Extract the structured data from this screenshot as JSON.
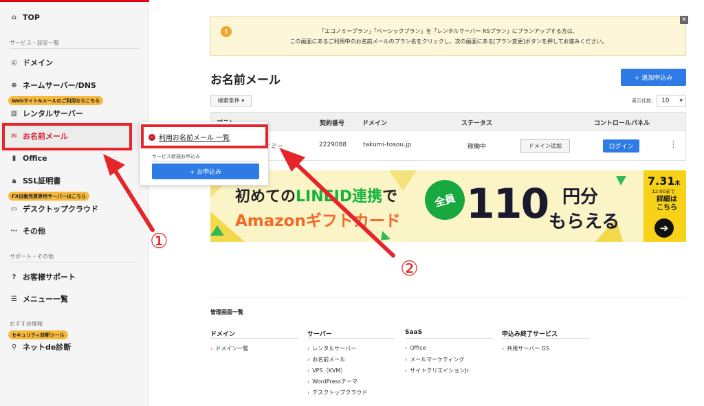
{
  "sidebar": {
    "top_label": "TOP",
    "section1": "サービス・設定一覧",
    "items": [
      {
        "label": "ドメイン",
        "icon": "domain-icon"
      },
      {
        "label": "ネームサーバー/DNS",
        "icon": "dns-icon"
      },
      {
        "label": "レンタルサーバー",
        "icon": "server-icon"
      },
      {
        "label": "お名前メール",
        "icon": "mail-icon"
      },
      {
        "label": "Office",
        "icon": "office-icon"
      },
      {
        "label": "SSL証明書",
        "icon": "lock-icon"
      },
      {
        "label": "デスクトップクラウド",
        "icon": "desktop-icon"
      },
      {
        "label": "その他",
        "icon": "more-icon"
      }
    ],
    "badge_web": "Webサイト&メールのご利用ならこちら",
    "badge_fx": "FX自動売買専用サーバーはこちら",
    "section2": "サポート・その他",
    "support_items": [
      {
        "label": "お客様サポート",
        "icon": "help-icon"
      },
      {
        "label": "メニュー一覧",
        "icon": "list-icon"
      }
    ],
    "section3": "おすすめ情報",
    "badge_security": "セキュリティ診断ツール",
    "recommend_item": "ネットde診断"
  },
  "popup": {
    "link": "利用お名前メール 一覧",
    "sub_heading": "サービス新規お申込み",
    "apply_button": "+ お申込み"
  },
  "notice": {
    "line1": "「エコノミープラン」「ベーシックプラン」を「レンタルサーバー RSプラン」にプランアップする方は、",
    "line2": "この画面にあるご利用中のお名前メールのプラン名をクリックし、次の画面にある[プラン変更]ボタンを押してお進みください。",
    "close": "✕"
  },
  "main": {
    "title": "お名前メール",
    "add_button": "+ 追加申込み",
    "filter": "検索条件 ▾",
    "count_label": "表示件数：",
    "count_value": "10",
    "table": {
      "headers": [
        "プラン",
        "契約番号",
        "ドメイン",
        "ステータス",
        "コントロールパネル"
      ],
      "row": {
        "plan": "エコノミー",
        "contract": "2229088",
        "domain": "takumi-tosou.jp",
        "status": "稼働中",
        "domain_add": "ドメイン追加",
        "login": "ログイン"
      }
    }
  },
  "banner": {
    "line1a": "初めての",
    "line1b": "LINEID連携",
    "line1c": "で",
    "line2": "Amazonギフトカード",
    "badge": "全員",
    "amount": "110",
    "yen": "円分",
    "receive": "もらえる",
    "date": "7.31",
    "weekday": "木",
    "until": "12:00まで",
    "details": "詳細は こちら"
  },
  "footer": {
    "title": "管理画面一覧",
    "columns": [
      {
        "heading": "ドメイン",
        "links": [
          "ドメイン一覧"
        ]
      },
      {
        "heading": "サーバー",
        "links": [
          "レンタルサーバー",
          "お名前メール",
          "VPS（KVM）",
          "WordPressテーマ",
          "デスクトップクラウド"
        ]
      },
      {
        "heading": "SaaS",
        "links": [
          "Office",
          "メールマーケティング",
          "サイトクリエイションJr."
        ]
      },
      {
        "heading": "申込み終了サービス",
        "links": [
          "共用サーバー GS"
        ]
      }
    ]
  },
  "annotations": {
    "step1": "①",
    "step2": "②"
  },
  "colors": {
    "accent_red": "#e5252a",
    "primary_blue": "#2f7be5",
    "notice_bg": "#fdf6d8"
  }
}
